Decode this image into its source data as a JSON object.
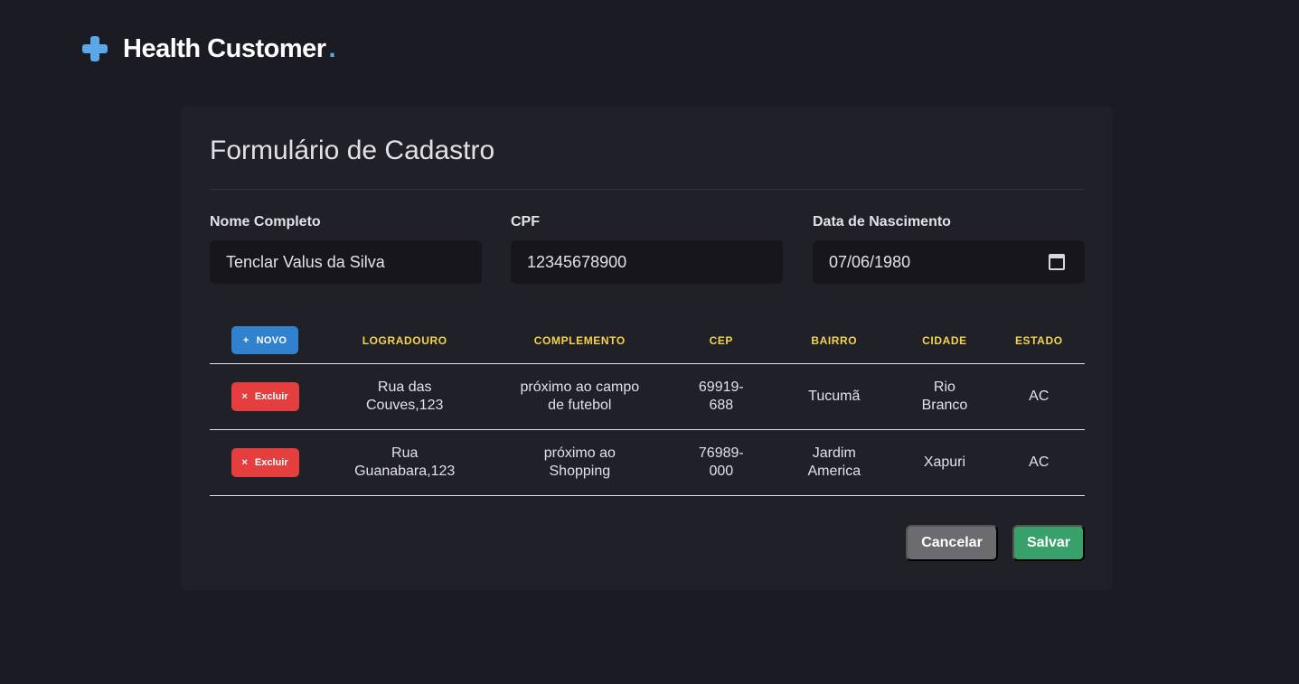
{
  "header": {
    "logo_icon": "plus-cross-icon",
    "brand": "Health Customer",
    "brand_dot": ".",
    "accent_color": "#5ba7e8"
  },
  "form": {
    "title": "Formulário de Cadastro",
    "fields": {
      "nome": {
        "label": "Nome Completo",
        "value": "Tenclar Valus da Silva"
      },
      "cpf": {
        "label": "CPF",
        "value": "12345678900"
      },
      "nascimento": {
        "label": "Data de Nascimento",
        "value": "07/06/1980",
        "icon": "calendar-icon"
      }
    }
  },
  "table": {
    "new_button": {
      "glyph": "+",
      "label": "NOVO",
      "color": "#3182ce"
    },
    "headers": [
      "LOGRADOURO",
      "COMPLEMENTO",
      "CEP",
      "BAIRRO",
      "CIDADE",
      "ESTADO"
    ],
    "header_color": "#f6d34b",
    "delete_button": {
      "glyph": "×",
      "label": "Excluir",
      "color": "#e53e3e"
    },
    "rows": [
      {
        "logradouro": "Rua das Couves,123",
        "complemento": "próximo ao campo de futebol",
        "cep": "69919-688",
        "bairro": "Tucumã",
        "cidade": "Rio Branco",
        "estado": "AC"
      },
      {
        "logradouro": "Rua Guanabara,123",
        "complemento": "próximo ao Shopping",
        "cep": "76989-000",
        "bairro": "Jardim America",
        "cidade": "Xapuri",
        "estado": "AC"
      }
    ]
  },
  "actions": {
    "cancel_label": "Cancelar",
    "save_label": "Salvar",
    "cancel_color": "#6b6b70",
    "save_color": "#38a169"
  }
}
